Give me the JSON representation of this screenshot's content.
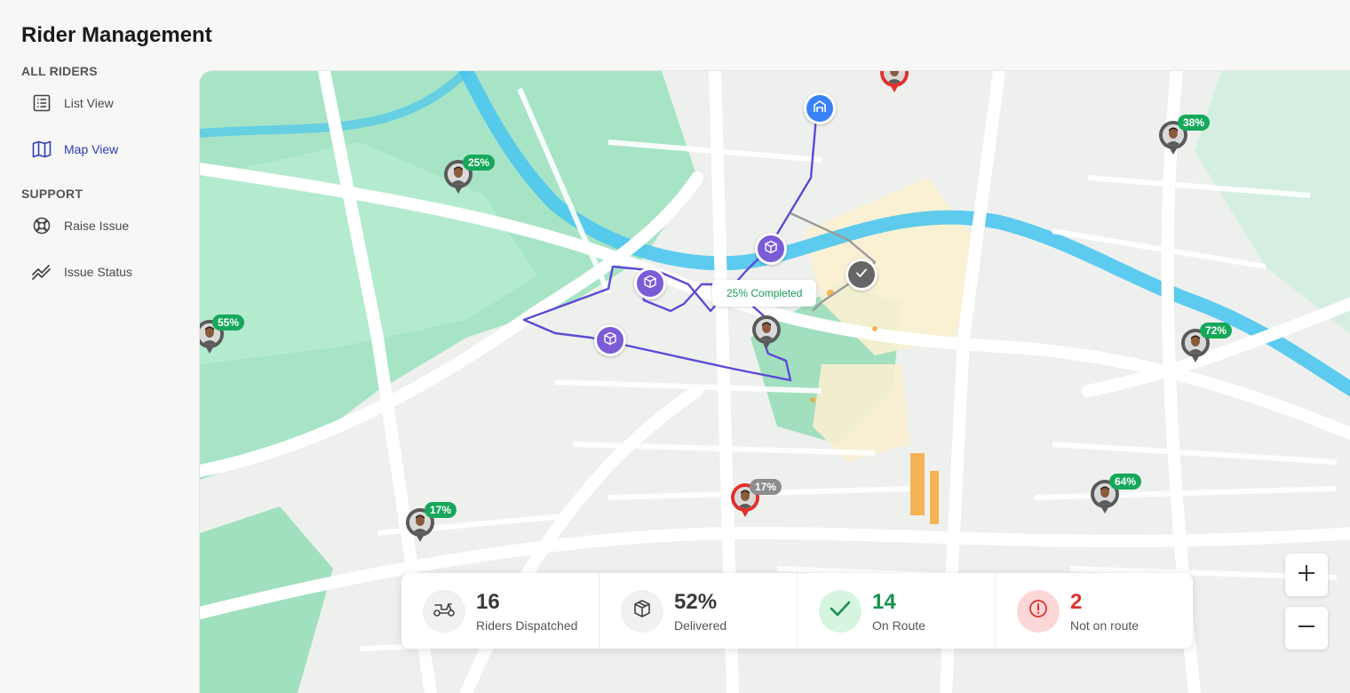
{
  "page": {
    "title": "Rider Management"
  },
  "sidebar": {
    "sections": [
      {
        "label": "ALL RIDERS",
        "items": [
          {
            "label": "List View",
            "icon": "list-icon"
          },
          {
            "label": "Map View",
            "icon": "map-icon",
            "active": true
          }
        ]
      },
      {
        "label": "SUPPORT",
        "items": [
          {
            "label": "Raise Issue",
            "icon": "lifebuoy-icon"
          },
          {
            "label": "Issue Status",
            "icon": "trend-icon"
          }
        ]
      }
    ]
  },
  "map": {
    "riders": [
      {
        "progress": "25%",
        "status": "on-route"
      },
      {
        "progress": "38%",
        "status": "on-route"
      },
      {
        "progress": "55%",
        "status": "on-route"
      },
      {
        "progress": "72%",
        "status": "on-route"
      },
      {
        "progress": "64%",
        "status": "on-route"
      },
      {
        "progress": "17%",
        "status": "on-route"
      },
      {
        "progress": "17%",
        "status": "not-on-route"
      }
    ],
    "tooltip": "25% Completed"
  },
  "stats": {
    "dispatched": {
      "value": "16",
      "label": "Riders Dispatched"
    },
    "delivered": {
      "value": "52%",
      "label": "Delivered"
    },
    "on_route": {
      "value": "14",
      "label": "On Route"
    },
    "not_on_route": {
      "value": "2",
      "label": "Not on route"
    }
  },
  "zoom": {
    "in": "+",
    "out": "−"
  },
  "colors": {
    "accent": "#2f3db4",
    "green": "#16a85a",
    "red": "#e0312b",
    "route": "#5b4bd6",
    "stop": "#7b5bd6",
    "water": "#3cc4ec",
    "park": "#5fd39a"
  }
}
